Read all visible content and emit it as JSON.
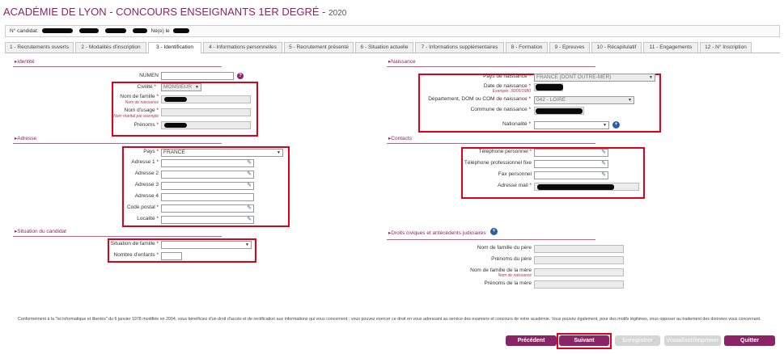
{
  "header": {
    "title": "ACADÉMIE DE LYON - CONCOURS ENSEIGNANTS 1ER DEGRÉ",
    "year": "2020"
  },
  "candidate": {
    "num_label": "N° candidat:",
    "born_label": "Né(e) le"
  },
  "tabs": [
    {
      "label": "1 - Recrutements ouverts"
    },
    {
      "label": "2 - Modalités d'inscription"
    },
    {
      "label": "3 - Identification"
    },
    {
      "label": "4 - Informations personnelles"
    },
    {
      "label": "5 - Recrutement présenté"
    },
    {
      "label": "6 - Situation actuelle"
    },
    {
      "label": "7 - Informations supplémentaires"
    },
    {
      "label": "8 - Formation"
    },
    {
      "label": "9 - Epreuves"
    },
    {
      "label": "10 - Récapitulatif"
    },
    {
      "label": "11 - Engagements"
    },
    {
      "label": "12 - N° Inscription"
    }
  ],
  "identite": {
    "title": "Identité",
    "numen_label": "NUMEN",
    "civilite_label": "Civilité",
    "civilite_value": "MONSIEUR",
    "nom_famille_label": "Nom de famille",
    "nom_famille_sub": "Nom de naissance",
    "nom_usage_label": "Nom d'usage",
    "nom_usage_sub": "Nom marital par exemple",
    "prenoms_label": "Prénoms"
  },
  "naissance": {
    "title": "Naissance",
    "pays_label": "Pays de naissance",
    "pays_value": "FRANCE (DONT OUTRE-MER)",
    "date_label": "Date de naissance",
    "date_sub": "Exemple: 30/05/1980",
    "dept_label": "Département, DOM ou COM de naissance",
    "dept_value": "042 - LOIRE",
    "commune_label": "Commune de naissance",
    "nationalite_label": "Nationalité"
  },
  "adresse": {
    "title": "Adresse",
    "pays_label": "Pays",
    "pays_value": "FRANCE",
    "a1_label": "Adresse 1",
    "a2_label": "Adresse 2",
    "a3_label": "Adresse 3",
    "a4_label": "Adresse 4",
    "cp_label": "Code postal",
    "loc_label": "Localité"
  },
  "contacts": {
    "title": "Contacts",
    "tel_perso_label": "Téléphone personnel",
    "tel_pro_label": "Téléphone professionnel fixe",
    "fax_label": "Fax personnel",
    "mail_label": "Adresse mail"
  },
  "situation": {
    "title": "Situation du candidat",
    "famille_label": "Situation de famille",
    "enfants_label": "Nombre d'enfants"
  },
  "droits": {
    "title": "Droits civiques et antécédents judiciaires",
    "pere_nom_label": "Nom de famille du père",
    "pere_prenoms_label": "Prénoms du père",
    "mere_nom_label": "Nom de famille de la mère",
    "mere_nom_sub": "Nom de naissance",
    "mere_prenoms_label": "Prénoms de la mère"
  },
  "legal_text": "Conformément à la \"loi informatique et libertés\" du 6 janvier 1978 modifiée en 2004, vous bénéficiez d'un droit d'accès et de rectification aux informations qui vous concernent ; vous pouvez exercer ce droit en vous adressant au service des examens et concours de votre académie. Vous pouvez également, pour des motifs légitimes, vous opposer au traitement des données vous concernant.",
  "buttons": {
    "precedent": "Précédent",
    "suivant": "Suivant",
    "enregistrer": "Enregistrer",
    "visualiser": "Visualiser/Imprimer",
    "quitter": "Quitter"
  },
  "colors": {
    "accent": "#8b2467",
    "highlight": "#e0001b"
  }
}
